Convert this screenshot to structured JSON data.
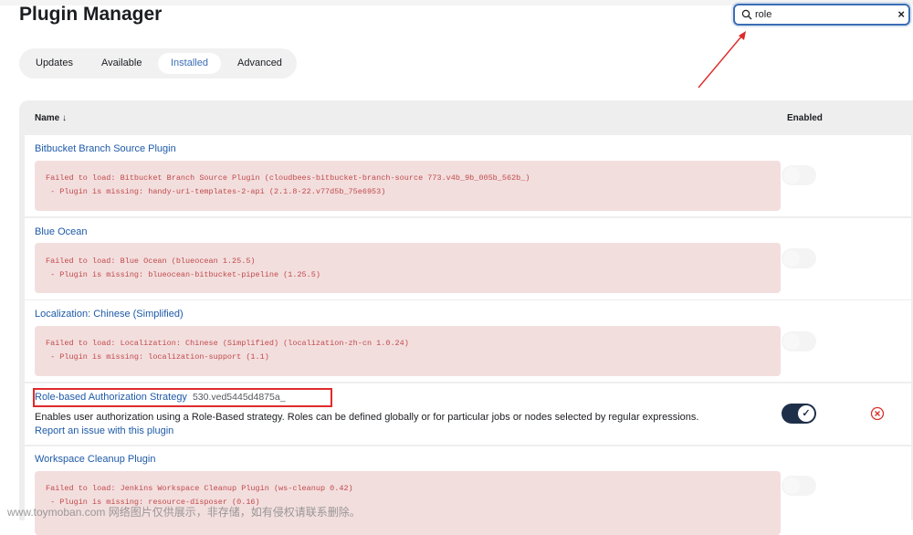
{
  "page": {
    "title": "Plugin Manager"
  },
  "search": {
    "value": "role",
    "search_icon": "search-icon",
    "clear_label": "×"
  },
  "tabs": [
    {
      "label": "Updates",
      "active": false
    },
    {
      "label": "Available",
      "active": false
    },
    {
      "label": "Installed",
      "active": true
    },
    {
      "label": "Advanced",
      "active": false
    }
  ],
  "table": {
    "headers": {
      "name": "Name ↓",
      "enabled": "Enabled"
    },
    "plugins": [
      {
        "name": "Bitbucket Branch Source Plugin",
        "error_line1": "Failed to load: Bitbucket Branch Source Plugin (cloudbees-bitbucket-branch-source 773.v4b_9b_005b_562b_)",
        "error_line2": " - Plugin is missing: handy-uri-templates-2-api (2.1.8-22.v77d5b_75e6953)",
        "enabled": false
      },
      {
        "name": "Blue Ocean",
        "error_line1": "Failed to load: Blue Ocean (blueocean 1.25.5)",
        "error_line2": " - Plugin is missing: blueocean-bitbucket-pipeline (1.25.5)",
        "enabled": false
      },
      {
        "name": "Localization: Chinese (Simplified)",
        "error_line1": "Failed to load: Localization: Chinese (Simplified) (localization-zh-cn 1.0.24)",
        "error_line2": " - Plugin is missing: localization-support (1.1)",
        "enabled": false
      },
      {
        "name": "Role-based Authorization Strategy",
        "version": "530.ved5445d4875a_",
        "description": "Enables user authorization using a Role-Based strategy. Roles can be defined globally or for particular jobs or nodes selected by regular expressions.",
        "report_link": "Report an issue with this plugin",
        "enabled": true
      },
      {
        "name": "Workspace Cleanup Plugin",
        "error_line1": "Failed to load: Jenkins Workspace Cleanup Plugin (ws-cleanup 0.42)",
        "error_line2": " - Plugin is missing: resource-disposer (0.16)",
        "enabled": false
      }
    ]
  },
  "watermark": "www.toymoban.com 网络图片仅供展示，非存储，如有侵权请联系删除。",
  "colors": {
    "link": "#1e5aa8",
    "error_bg": "#f3dede",
    "error_text": "#c04b4b",
    "toggle_on": "#1e2f4a",
    "annotation_red": "#e02a2a"
  }
}
